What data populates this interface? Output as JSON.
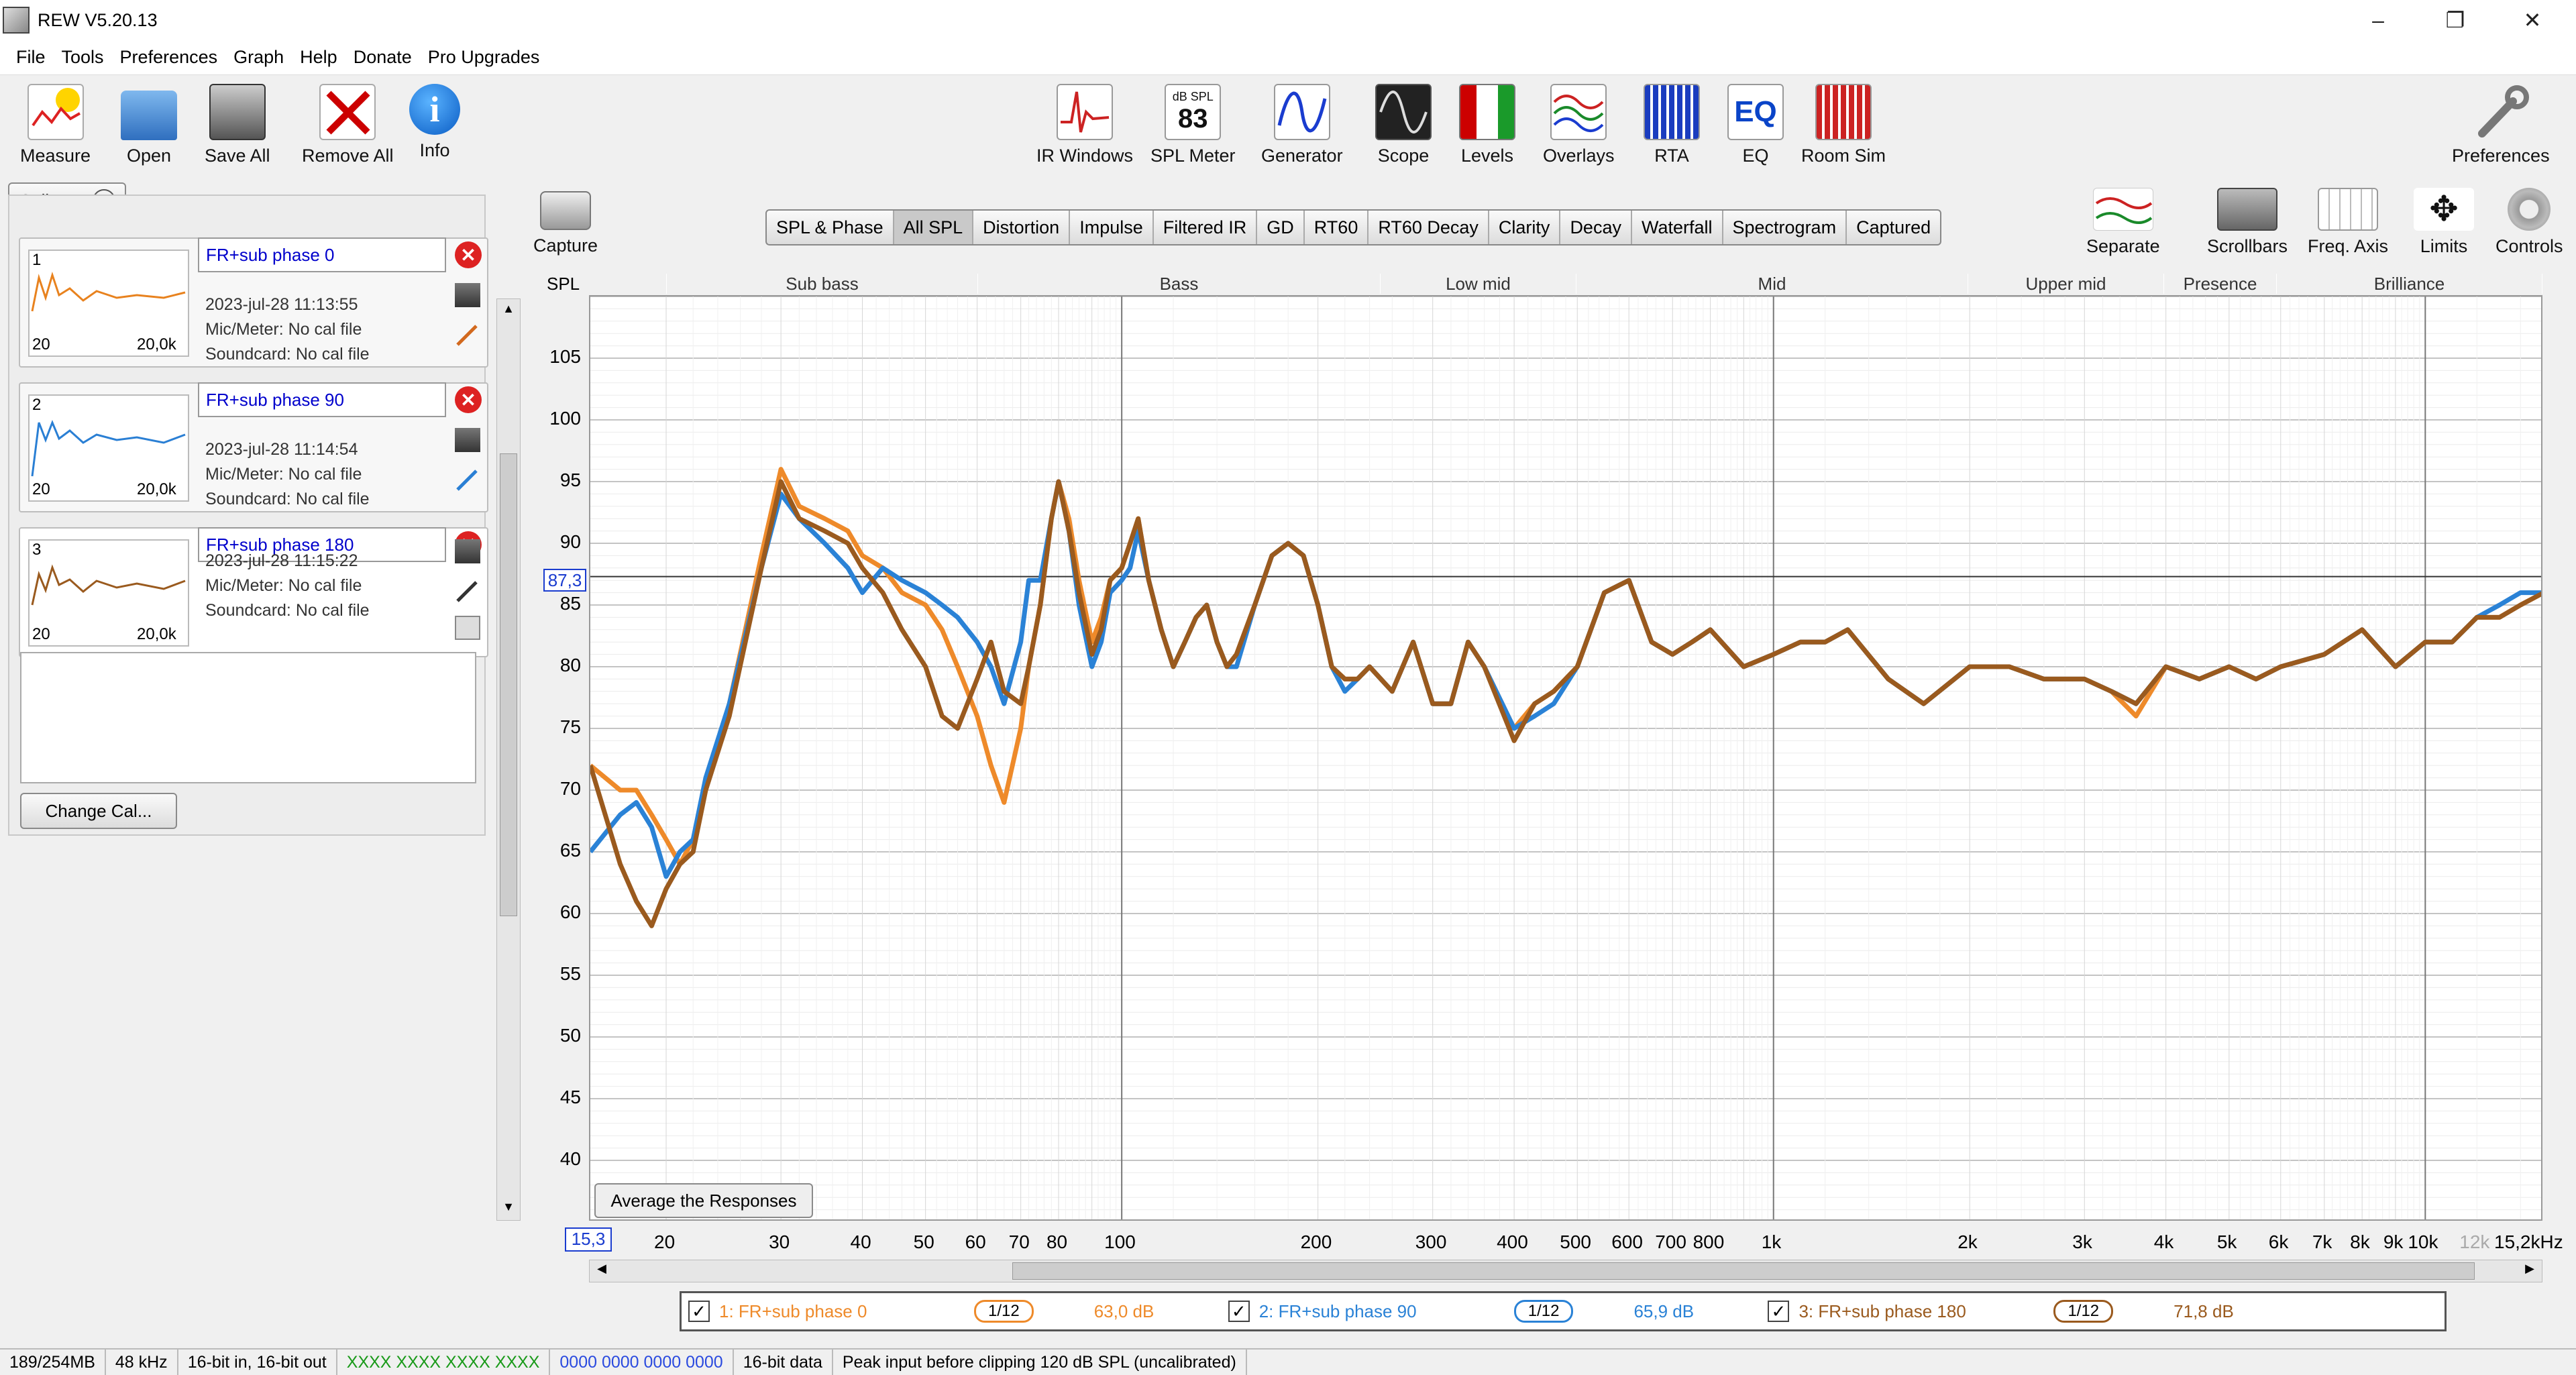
{
  "window": {
    "title": "REW V5.20.13",
    "minimize": "–",
    "restore": "❐",
    "close": "✕"
  },
  "menu": [
    "File",
    "Tools",
    "Preferences",
    "Graph",
    "Help",
    "Donate",
    "Pro Upgrades"
  ],
  "toolbar_left": [
    {
      "label": "Measure",
      "icon": "measure-icon"
    },
    {
      "label": "Open",
      "icon": "folder-icon"
    },
    {
      "label": "Save All",
      "icon": "save-icon"
    },
    {
      "label": "Remove All",
      "icon": "remove-icon"
    },
    {
      "label": "Info",
      "icon": "info-icon"
    }
  ],
  "toolbar_center": [
    {
      "label": "IR Windows",
      "icon": "ir-windows-icon"
    },
    {
      "label": "SPL Meter",
      "icon": "spl-meter-icon"
    },
    {
      "label": "Generator",
      "icon": "generator-icon"
    },
    {
      "label": "Scope",
      "icon": "scope-icon"
    },
    {
      "label": "Levels",
      "icon": "levels-icon"
    },
    {
      "label": "Overlays",
      "icon": "overlays-icon"
    },
    {
      "label": "RTA",
      "icon": "rta-icon"
    },
    {
      "label": "EQ",
      "icon": "eq-icon"
    },
    {
      "label": "Room Sim",
      "icon": "room-sim-icon"
    }
  ],
  "spl_meter_icon": {
    "unit": "dB SPL",
    "value": "83"
  },
  "eq_icon_text": "EQ",
  "preferences_label": "Preferences",
  "collapse_label": "Collapse",
  "measurements": [
    {
      "num": "1",
      "name": "FR+sub phase 0",
      "date": "2023-jul-28 11:13:55",
      "mic": "Mic/Meter: No cal file",
      "soundcard": "Soundcard: No cal file",
      "x0": "20",
      "x1": "20,0k",
      "color": "#e8821e"
    },
    {
      "num": "2",
      "name": "FR+sub phase 90",
      "date": "2023-jul-28 11:14:54",
      "mic": "Mic/Meter: No cal file",
      "soundcard": "Soundcard: No cal file",
      "x0": "20",
      "x1": "20,0k",
      "color": "#2a7fd4"
    },
    {
      "num": "3",
      "name": "FR+sub phase 180",
      "date": "2023-jul-28 11:15:22",
      "mic": "Mic/Meter: No cal file",
      "soundcard": "Soundcard: No cal file",
      "x0": "20",
      "x1": "20,0k",
      "color": "#9a5a1e"
    }
  ],
  "change_cal_label": "Change Cal...",
  "capture_label": "Capture",
  "graph_tabs": [
    "SPL & Phase",
    "All SPL",
    "Distortion",
    "Impulse",
    "Filtered IR",
    "GD",
    "RT60",
    "RT60 Decay",
    "Clarity",
    "Decay",
    "Waterfall",
    "Spectrogram",
    "Captured"
  ],
  "selected_tab": "All SPL",
  "right_tools": [
    {
      "label": "Separate",
      "icon": "separate-icon"
    },
    {
      "label": "Scrollbars",
      "icon": "scrollbars-icon"
    },
    {
      "label": "Freq. Axis",
      "icon": "freq-axis-icon"
    },
    {
      "label": "Limits",
      "icon": "limits-icon"
    },
    {
      "label": "Controls",
      "icon": "controls-icon"
    }
  ],
  "spl_label": "SPL",
  "bands": [
    {
      "name": "",
      "color": "#f5a6d0"
    },
    {
      "name": "Sub bass",
      "color": "#f0989c"
    },
    {
      "name": "Bass",
      "color": "#f8d98c"
    },
    {
      "name": "Low mid",
      "color": "#d2e690"
    },
    {
      "name": "Mid",
      "color": "#a6dea6"
    },
    {
      "name": "Upper mid",
      "color": "#a8dcd6"
    },
    {
      "name": "Presence",
      "color": "#a9bde8"
    },
    {
      "name": "Brilliance",
      "color": "#b9a7da"
    }
  ],
  "cursor_readout": "87,3",
  "x_start_readout": "15,3",
  "average_button": "Average the Responses",
  "chart_data": {
    "type": "line",
    "xscale": "log",
    "xlim": [
      15.3,
      15200
    ],
    "ylim": [
      35,
      110
    ],
    "yticks": [
      "105",
      "100",
      "95",
      "90",
      "85",
      "80",
      "75",
      "70",
      "65",
      "60",
      "55",
      "50",
      "45",
      "40"
    ],
    "xticks": [
      "20",
      "30",
      "40",
      "50",
      "60",
      "70",
      "80",
      "100",
      "200",
      "300",
      "400",
      "500",
      "600",
      "700",
      "800",
      "1k",
      "2k",
      "3k",
      "4k",
      "5k",
      "6k",
      "7k",
      "8k",
      "9k",
      "10k",
      "12k",
      "15,2kHz"
    ],
    "cursor_y": 87.3,
    "series": [
      {
        "name": "1: FR+sub phase 0",
        "color": "#ee8a2a",
        "x": [
          15.3,
          17,
          18,
          19,
          20,
          21,
          22,
          23,
          25,
          28,
          30,
          32,
          35,
          38,
          40,
          43,
          46,
          50,
          53,
          56,
          60,
          63,
          66,
          70,
          72,
          75,
          78,
          80,
          83,
          86,
          90,
          93,
          96,
          100,
          103,
          106,
          110,
          115,
          120,
          125,
          130,
          135,
          140,
          145,
          150,
          160,
          170,
          180,
          190,
          200,
          210,
          220,
          230,
          240,
          260,
          280,
          300,
          320,
          340,
          360,
          400,
          430,
          460,
          500,
          550,
          600,
          650,
          700,
          750,
          800,
          900,
          1000,
          1100,
          1200,
          1300,
          1500,
          1700,
          2000,
          2300,
          2600,
          3000,
          3300,
          3600,
          4000,
          4500,
          5000,
          5500,
          6000,
          7000,
          8000,
          9000,
          10000,
          11000,
          12000,
          13000,
          14000,
          15200
        ],
        "y": [
          72,
          70,
          70,
          68,
          66,
          64,
          66,
          70,
          77,
          89,
          96,
          93,
          92,
          91,
          89,
          88,
          86,
          85,
          83,
          80,
          76,
          72,
          69,
          75,
          80,
          85,
          92,
          95,
          92,
          87,
          82,
          84,
          87,
          88,
          90,
          92,
          87,
          83,
          80,
          82,
          84,
          85,
          82,
          80,
          81,
          85,
          89,
          90,
          89,
          85,
          80,
          79,
          79,
          80,
          78,
          82,
          77,
          77,
          82,
          80,
          75,
          77,
          78,
          80,
          86,
          87,
          82,
          81,
          82,
          83,
          80,
          81,
          82,
          82,
          83,
          79,
          77,
          80,
          80,
          79,
          79,
          78,
          76,
          80,
          79,
          80,
          79,
          80,
          81,
          83,
          80,
          82,
          82,
          84,
          84,
          85,
          86
        ]
      },
      {
        "name": "2: FR+sub phase 90",
        "color": "#2a82d6",
        "x": [
          15.3,
          17,
          18,
          19,
          20,
          21,
          22,
          23,
          25,
          28,
          30,
          32,
          35,
          38,
          40,
          43,
          46,
          50,
          53,
          56,
          60,
          63,
          66,
          70,
          72,
          75,
          78,
          80,
          83,
          86,
          90,
          93,
          96,
          100,
          103,
          106,
          110,
          115,
          120,
          125,
          130,
          135,
          140,
          145,
          150,
          160,
          170,
          180,
          190,
          200,
          210,
          220,
          230,
          240,
          260,
          280,
          300,
          320,
          340,
          360,
          400,
          430,
          460,
          500,
          550,
          600,
          650,
          700,
          750,
          800,
          900,
          1000,
          1100,
          1200,
          1300,
          1500,
          1700,
          2000,
          2300,
          2600,
          3000,
          3300,
          3600,
          4000,
          4500,
          5000,
          5500,
          6000,
          7000,
          8000,
          9000,
          10000,
          11000,
          12000,
          13000,
          14000,
          15200
        ],
        "y": [
          65,
          68,
          69,
          67,
          63,
          65,
          66,
          71,
          77,
          88,
          94,
          92,
          90,
          88,
          86,
          88,
          87,
          86,
          85,
          84,
          82,
          80,
          77,
          82,
          87,
          87,
          92,
          95,
          91,
          85,
          80,
          82,
          86,
          87,
          88,
          91,
          87,
          83,
          80,
          82,
          84,
          85,
          82,
          80,
          80,
          85,
          89,
          90,
          89,
          85,
          80,
          78,
          79,
          80,
          78,
          82,
          77,
          77,
          82,
          80,
          75,
          76,
          77,
          80,
          86,
          87,
          82,
          81,
          82,
          83,
          80,
          81,
          82,
          82,
          83,
          79,
          77,
          80,
          80,
          79,
          79,
          78,
          77,
          80,
          79,
          80,
          79,
          80,
          81,
          83,
          80,
          82,
          82,
          84,
          85,
          86,
          86
        ]
      },
      {
        "name": "3: FR+sub phase 180",
        "color": "#9a5a1e",
        "x": [
          15.3,
          17,
          18,
          19,
          20,
          21,
          22,
          23,
          25,
          28,
          30,
          32,
          35,
          38,
          40,
          43,
          46,
          50,
          53,
          56,
          60,
          63,
          66,
          70,
          72,
          75,
          78,
          80,
          83,
          86,
          90,
          93,
          96,
          100,
          103,
          106,
          110,
          115,
          120,
          125,
          130,
          135,
          140,
          145,
          150,
          160,
          170,
          180,
          190,
          200,
          210,
          220,
          230,
          240,
          260,
          280,
          300,
          320,
          340,
          360,
          400,
          430,
          460,
          500,
          550,
          600,
          650,
          700,
          750,
          800,
          900,
          1000,
          1100,
          1200,
          1300,
          1500,
          1700,
          2000,
          2300,
          2600,
          3000,
          3300,
          3600,
          4000,
          4500,
          5000,
          5500,
          6000,
          7000,
          8000,
          9000,
          10000,
          11000,
          12000,
          13000,
          14000,
          15200
        ],
        "y": [
          72,
          64,
          61,
          59,
          62,
          64,
          65,
          70,
          76,
          88,
          95,
          92,
          91,
          90,
          88,
          86,
          83,
          80,
          76,
          75,
          79,
          82,
          78,
          77,
          80,
          85,
          92,
          95,
          91,
          86,
          81,
          83,
          87,
          88,
          90,
          92,
          87,
          83,
          80,
          82,
          84,
          85,
          82,
          80,
          81,
          85,
          89,
          90,
          89,
          85,
          80,
          79,
          79,
          80,
          78,
          82,
          77,
          77,
          82,
          80,
          74,
          77,
          78,
          80,
          86,
          87,
          82,
          81,
          82,
          83,
          80,
          81,
          82,
          82,
          83,
          79,
          77,
          80,
          80,
          79,
          79,
          78,
          77,
          80,
          79,
          80,
          79,
          80,
          81,
          83,
          80,
          82,
          82,
          84,
          84,
          85,
          86
        ]
      }
    ]
  },
  "legend": [
    {
      "label": "1: FR+sub phase 0",
      "smoothing": "1/12",
      "db": "63,0 dB",
      "color": "#ee8a2a"
    },
    {
      "label": "2: FR+sub phase 90",
      "smoothing": "1/12",
      "db": "65,9 dB",
      "color": "#2a82d6"
    },
    {
      "label": "3: FR+sub phase 180",
      "smoothing": "1/12",
      "db": "71,8 dB",
      "color": "#9a5a1e"
    }
  ],
  "status": [
    "189/254MB",
    "48 kHz",
    "16-bit in, 16-bit out",
    "XXXX XXXX  XXXX XXXX",
    "0000 0000  0000 0000",
    "16-bit data",
    "Peak input before clipping 120 dB SPL (uncalibrated)"
  ]
}
